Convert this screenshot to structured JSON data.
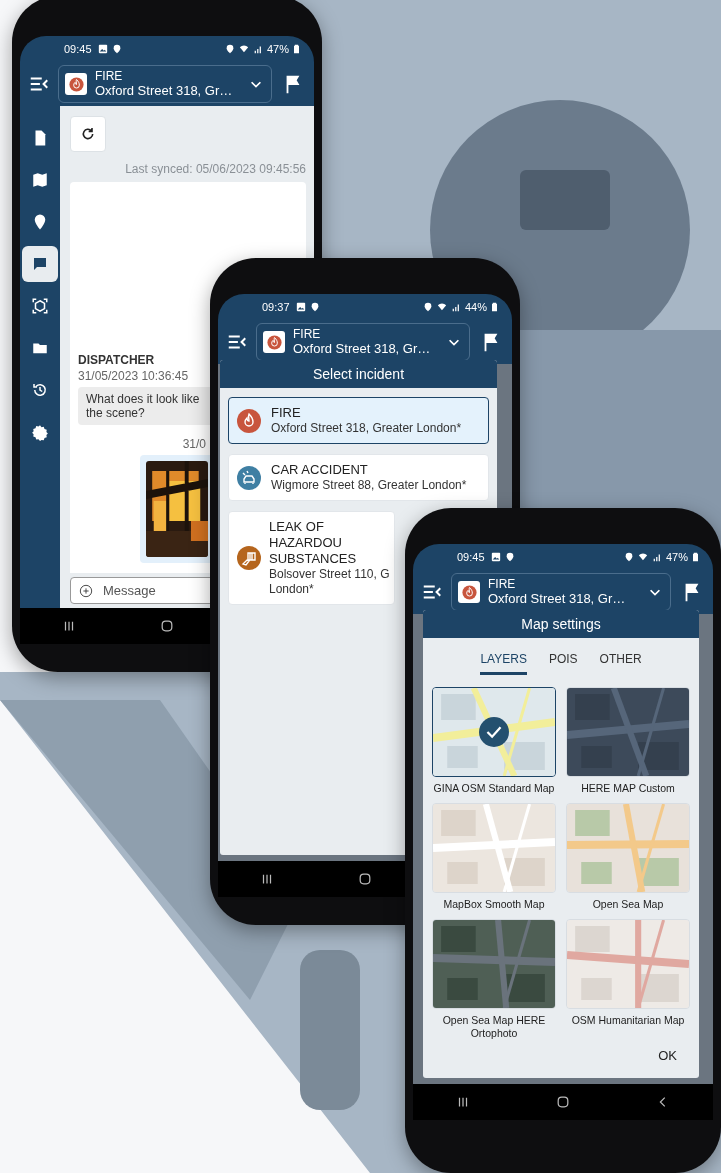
{
  "phones": [
    {
      "kind": "chat",
      "status_bar": {
        "time": "09:45",
        "battery": "47%"
      },
      "incident": {
        "title": "FIRE",
        "address": "Oxford Street 318, Gr…"
      },
      "sidebar": [
        {
          "selected": false
        },
        {
          "selected": false
        },
        {
          "selected": false
        },
        {
          "selected": true
        },
        {
          "selected": false
        },
        {
          "selected": false
        },
        {
          "selected": false
        },
        {
          "selected": false
        }
      ],
      "last_synced": "Last synced: 05/06/2023 09:45:56",
      "messages": [
        {
          "kind": "text",
          "sender": "DISPATCHER",
          "time": "31/05/2023 10:36:45",
          "lines": [
            "What does it look like",
            "the scene?"
          ]
        },
        {
          "time": "31/0"
        }
      ],
      "message_field": {
        "placeholder": "Message"
      }
    },
    {
      "kind": "incident_picker",
      "status_bar": {
        "time": "09:37",
        "battery": "44%"
      },
      "incident": {
        "title": "FIRE",
        "address": "Oxford Street 318, Gr…"
      },
      "dialog": {
        "title": "Select incident",
        "incidents": [
          {
            "title": "FIRE",
            "address": "Oxford Street 318, Greater London*",
            "color": "#c8553d",
            "selected": true
          },
          {
            "title": "CAR ACCIDENT",
            "address": "Wigmore Street 88, Greater London*",
            "color": "#3f7fa3",
            "selected": false
          },
          {
            "title": "LEAK OF HAZARDOU\nSUBSTANCES",
            "address": "Bolsover Street 110, G\nLondon*",
            "color": "#b5651d",
            "selected": false
          }
        ]
      }
    },
    {
      "kind": "map_settings",
      "status_bar": {
        "time": "09:45",
        "battery": "47%"
      },
      "incident": {
        "title": "FIRE",
        "address": "Oxford Street 318, Gr…"
      },
      "dialog": {
        "title": "Map settings",
        "tabs": [
          {
            "label": "LAYERS",
            "selected": true
          },
          {
            "label": "POIS",
            "selected": false
          },
          {
            "label": "OTHER",
            "selected": false
          }
        ],
        "layers": [
          {
            "name": "GINA OSM Standard Map",
            "selected": true
          },
          {
            "name": "HERE MAP Custom",
            "selected": false
          },
          {
            "name": "MapBox Smooth Map",
            "selected": false
          },
          {
            "name": "Open Sea Map",
            "selected": false
          },
          {
            "name": "Open Sea Map HERE Ortophoto",
            "selected": false
          },
          {
            "name": "OSM Humanitarian Map",
            "selected": false
          }
        ],
        "button": "OK"
      }
    }
  ]
}
